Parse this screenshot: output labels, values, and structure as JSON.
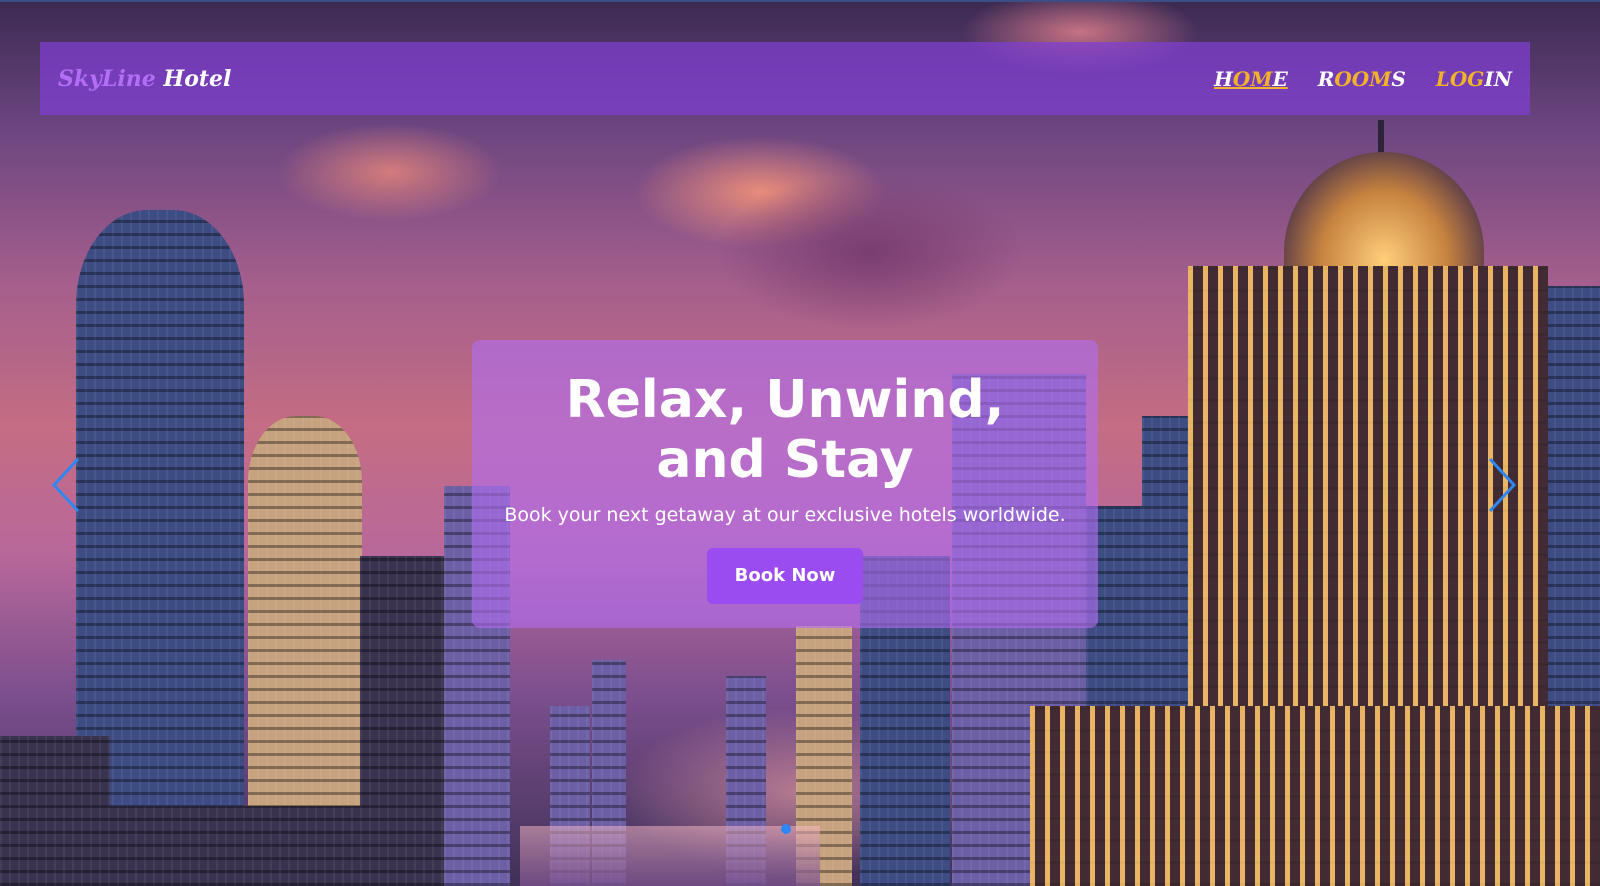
{
  "navbar": {
    "brand_part1": "SkyLine",
    "brand_part2": "Hotel",
    "links": [
      {
        "label_a": "H",
        "label_b": "OM",
        "label_c": "E",
        "active": true
      },
      {
        "label_a": "R",
        "label_b": "OOM",
        "label_c": "S",
        "active": false
      },
      {
        "label_a": "LOG",
        "label_b": "IN",
        "active": false
      }
    ]
  },
  "hero": {
    "title": "Relax, Unwind, and Stay",
    "subtitle": "Book your next getaway at our exclusive hotels worldwide.",
    "cta_label": "Book Now"
  },
  "carousel": {
    "prev_icon": "chevron-left-icon",
    "next_icon": "chevron-right-icon",
    "slide_count": 1,
    "active_slide": 1
  },
  "colors": {
    "navbar_bg": "#803ed2",
    "brand_accent": "#b36ef5",
    "nav_highlight": "#f2b32a",
    "button_bg": "#9b4cf0",
    "arrow": "#2f87f5"
  }
}
